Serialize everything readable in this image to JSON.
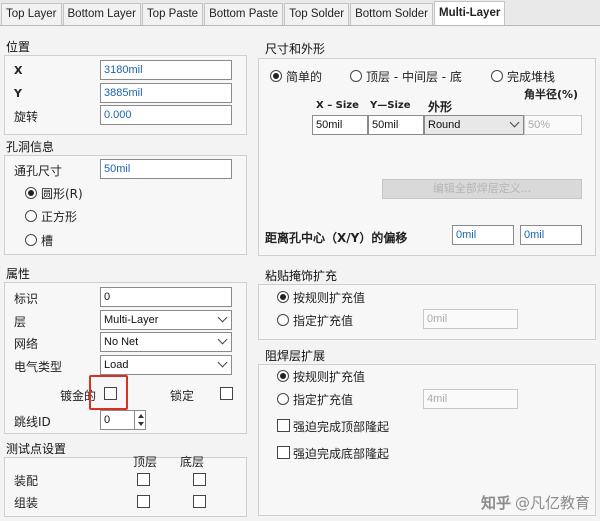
{
  "tabs": [
    "Top Layer",
    "Bottom Layer",
    "Top Paste",
    "Bottom Paste",
    "Top Solder",
    "Bottom Solder",
    "Multi-Layer"
  ],
  "active_tab": "Multi-Layer",
  "location": {
    "title": "位置",
    "x_label": "X",
    "x_value": "3180mil",
    "y_label": "Y",
    "y_value": "3885mil",
    "rotation_label": "旋转",
    "rotation_value": "0.000"
  },
  "hole": {
    "title": "孔洞信息",
    "size_label": "通孔尺寸",
    "size_value": "50mil",
    "round": "圆形(R)",
    "square": "正方形",
    "slot": "槽"
  },
  "properties": {
    "title": "属性",
    "designator_label": "标识",
    "designator_value": "0",
    "layer_label": "层",
    "layer_value": "Multi-Layer",
    "net_label": "网络",
    "net_value": "No Net",
    "etype_label": "电气类型",
    "etype_value": "Load",
    "plated_label": "镀金的",
    "locked_label": "锁定",
    "jumper_label": "跳线ID",
    "jumper_value": "0"
  },
  "testpoint": {
    "title": "测试点设置",
    "top": "顶层",
    "bottom": "底层",
    "assembly": "装配",
    "fabrication": "组装"
  },
  "size_shape": {
    "title": "尺寸和外形",
    "simple": "简单的",
    "top_mid_bottom": "顶层 - 中间层 - 底",
    "full_stack": "完成堆栈",
    "corner_radius": "角半径(%)",
    "x_size_header": "X – Size",
    "y_size_header": "Y—Size",
    "shape_header": "外形",
    "x_size": "50mil",
    "y_size": "50mil",
    "shape": "Round",
    "radius": "50%",
    "edit_button": "编辑全部焊层定义...",
    "offset_label": "距离孔中心（X/Y）的偏移",
    "offset_x": "0mil",
    "offset_y": "0mil"
  },
  "paste": {
    "title": "粘贴掩饰扩充",
    "rule": "按规则扩充值",
    "specify": "指定扩充值",
    "value": "0mil"
  },
  "solder": {
    "title": "阻焊层扩展",
    "rule": "按规则扩充值",
    "specify": "指定扩充值",
    "value": "4mil",
    "force_top": "强迫完成顶部隆起",
    "force_bottom": "强迫完成底部隆起"
  },
  "watermark": {
    "logo": "知乎",
    "text": "@凡亿教育"
  }
}
